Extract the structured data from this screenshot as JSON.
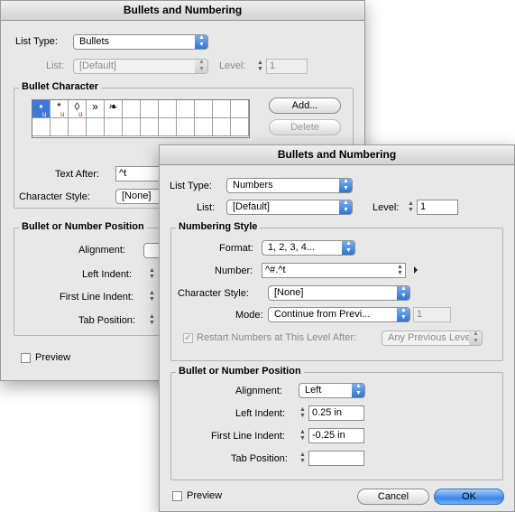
{
  "back": {
    "title": "Bullets and Numbering",
    "list_type_label": "List Type:",
    "list_type_value": "Bullets",
    "list_label": "List:",
    "list_value": "[Default]",
    "level_label": "Level:",
    "level_value": "1",
    "bullet_char_title": "Bullet Character",
    "add_button": "Add...",
    "delete_button": "Delete",
    "glyphs": [
      "•",
      "*",
      "◊",
      "»",
      "❧"
    ],
    "text_after_label": "Text After:",
    "text_after_value": "^t",
    "char_style_label": "Character Style:",
    "char_style_value": "[None]",
    "position_title": "Bullet or Number Position",
    "alignment_label": "Alignment:",
    "left_indent_label": "Left Indent:",
    "first_line_label": "First Line Indent:",
    "tab_position_label": "Tab Position:",
    "preview_label": "Preview"
  },
  "front": {
    "title": "Bullets and Numbering",
    "list_type_label": "List Type:",
    "list_type_value": "Numbers",
    "list_label": "List:",
    "list_value": "[Default]",
    "level_label": "Level:",
    "level_value": "1",
    "numbering_title": "Numbering Style",
    "format_label": "Format:",
    "format_value": "1, 2, 3, 4...",
    "number_label": "Number:",
    "number_value": "^#.^t",
    "char_style_label": "Character Style:",
    "char_style_value": "[None]",
    "mode_label": "Mode:",
    "mode_value": "Continue from Previ...",
    "mode_start": "1",
    "restart_label": "Restart Numbers at This Level After:",
    "restart_value": "Any Previous Level",
    "position_title": "Bullet or Number Position",
    "alignment_label": "Alignment:",
    "alignment_value": "Left",
    "left_indent_label": "Left Indent:",
    "left_indent_value": "0.25 in",
    "first_line_label": "First Line Indent:",
    "first_line_value": "-0.25 in",
    "tab_position_label": "Tab Position:",
    "tab_position_value": "",
    "preview_label": "Preview",
    "cancel_button": "Cancel",
    "ok_button": "OK"
  }
}
